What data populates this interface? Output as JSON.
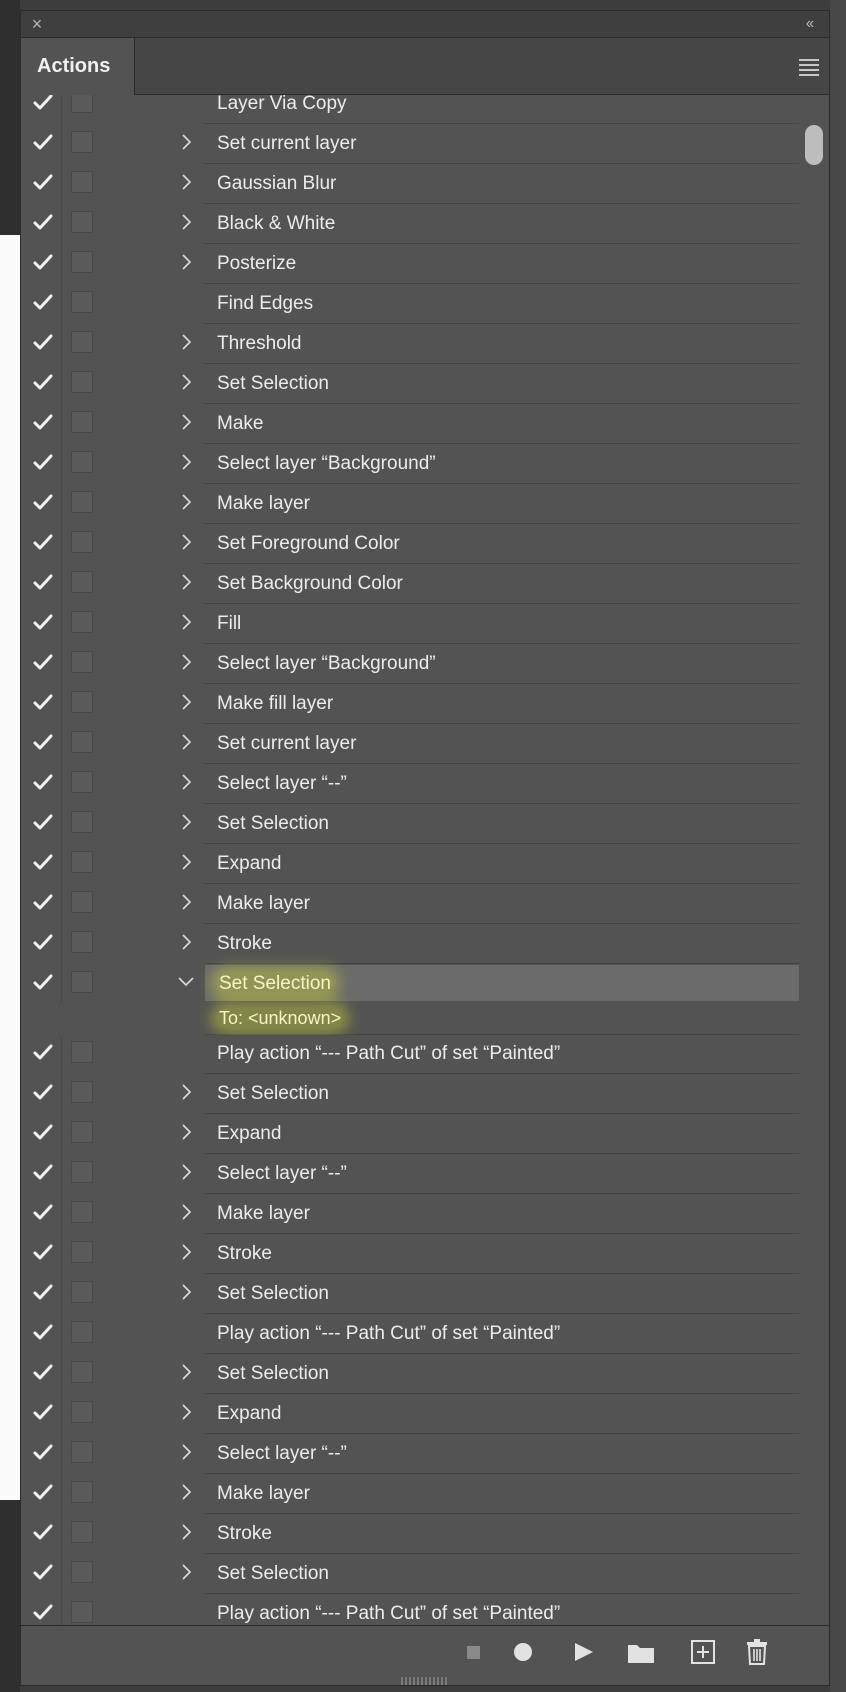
{
  "panel": {
    "tab_label": "Actions",
    "close_glyph": "×",
    "collapse_glyph": "‹‹"
  },
  "rows": [
    {
      "label": "Layer Via Copy",
      "expand": false
    },
    {
      "label": "Set current layer",
      "expand": true
    },
    {
      "label": "Gaussian Blur",
      "expand": true
    },
    {
      "label": "Black & White",
      "expand": true
    },
    {
      "label": "Posterize",
      "expand": true
    },
    {
      "label": "Find Edges",
      "expand": false
    },
    {
      "label": "Threshold",
      "expand": true
    },
    {
      "label": "Set Selection",
      "expand": true
    },
    {
      "label": "Make",
      "expand": true
    },
    {
      "label": "Select layer “Background”",
      "expand": true
    },
    {
      "label": "Make layer",
      "expand": true
    },
    {
      "label": "Set Foreground Color",
      "expand": true
    },
    {
      "label": "Set Background Color",
      "expand": true
    },
    {
      "label": "Fill",
      "expand": true
    },
    {
      "label": "Select layer “Background”",
      "expand": true
    },
    {
      "label": "Make fill layer",
      "expand": true
    },
    {
      "label": "Set current layer",
      "expand": true
    },
    {
      "label": "Select layer “--”",
      "expand": true
    },
    {
      "label": "Set Selection",
      "expand": true
    },
    {
      "label": "Expand",
      "expand": true
    },
    {
      "label": "Make layer",
      "expand": true
    },
    {
      "label": "Stroke",
      "expand": true
    },
    {
      "label": "Set Selection",
      "expand": true,
      "expanded": true,
      "selected": true,
      "detail": "To: <unknown>"
    },
    {
      "label": "Play action “--- Path Cut” of set “Painted”",
      "expand": false
    },
    {
      "label": "Set Selection",
      "expand": true
    },
    {
      "label": "Expand",
      "expand": true
    },
    {
      "label": "Select layer “--”",
      "expand": true
    },
    {
      "label": "Make layer",
      "expand": true
    },
    {
      "label": "Stroke",
      "expand": true
    },
    {
      "label": "Set Selection",
      "expand": true
    },
    {
      "label": "Play action “--- Path Cut” of set “Painted”",
      "expand": false
    },
    {
      "label": "Set Selection",
      "expand": true
    },
    {
      "label": "Expand",
      "expand": true
    },
    {
      "label": "Select layer “--”",
      "expand": true
    },
    {
      "label": "Make layer",
      "expand": true
    },
    {
      "label": "Stroke",
      "expand": true
    },
    {
      "label": "Set Selection",
      "expand": true
    },
    {
      "label": "Play action “--- Path Cut” of set “Painted”",
      "expand": false
    }
  ],
  "toolbar": {
    "buttons": [
      "stop-icon",
      "record-icon",
      "play-icon",
      "folder-icon",
      "new-action-icon",
      "trash-icon"
    ]
  },
  "colors": {
    "panel_bg": "#535353",
    "selected_row": "#6b6b6b",
    "highlight": "#d6e132"
  }
}
